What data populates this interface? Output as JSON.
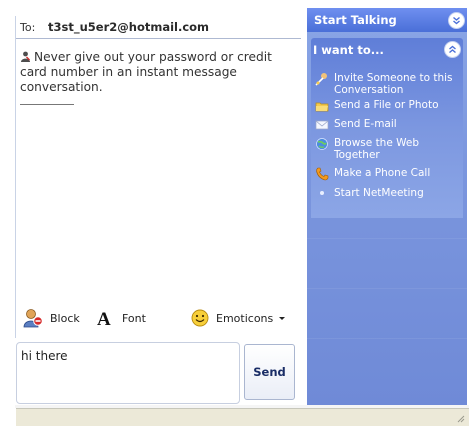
{
  "conversation": {
    "to_label": "To:",
    "to_address": "t3st_u5er2@hotmail.com",
    "warning": "Never give out your password or credit card number in an instant message conversation."
  },
  "toolbar": {
    "block_label": "Block",
    "font_label": "Font",
    "emoticons_label": "Emoticons"
  },
  "compose": {
    "message": "hi there",
    "send_label": "Send"
  },
  "task_pane": {
    "header": "Start Talking",
    "group_title": "I want to...",
    "items": [
      {
        "label": "Invite Someone to this Conversation",
        "icon": "invite-icon"
      },
      {
        "label": "Send a File or Photo",
        "icon": "folder-icon"
      },
      {
        "label": "Send E-mail",
        "icon": "envelope-icon"
      },
      {
        "label": "Browse the Web Together",
        "icon": "globe-icon"
      },
      {
        "label": "Make a Phone Call",
        "icon": "phone-icon"
      },
      {
        "label": "Start NetMeeting",
        "icon": "bullet-icon"
      }
    ]
  },
  "colors": {
    "pane_blue": "#7b96de",
    "header_blue": "#4a6fd8",
    "send_text": "#1a2d66"
  }
}
